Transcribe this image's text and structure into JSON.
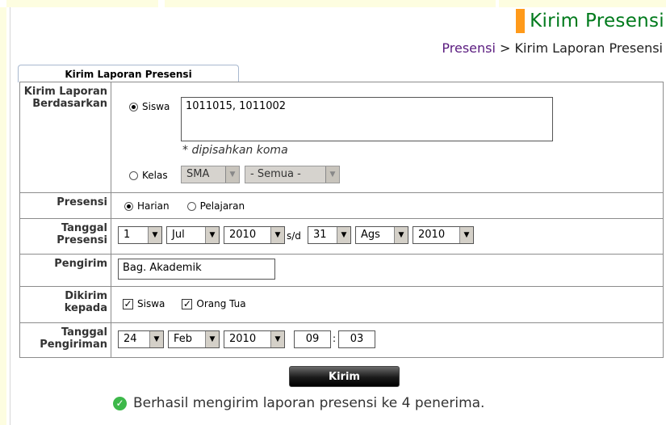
{
  "title": "Kirim Presensi",
  "breadcrumb": {
    "link": "Presensi",
    "separator": ">",
    "current": "Kirim Laporan Presensi"
  },
  "tab": "Kirim Laporan Presensi",
  "rows": {
    "kirim": {
      "label": "Kirim Laporan Berdasarkan",
      "siswa_label": "Siswa",
      "siswa_value": "1011015, 1011002",
      "hint": "* dipisahkan koma",
      "kelas_label": "Kelas",
      "kelas_level": "SMA",
      "kelas_class": "- Semua -"
    },
    "presensi": {
      "label": "Presensi",
      "opt1": "Harian",
      "opt2": "Pelajaran",
      "selected": "Harian"
    },
    "tanggal": {
      "label": "Tanggal Presensi",
      "from_day": "1",
      "from_month": "Jul",
      "from_year": "2010",
      "sep": "s/d",
      "to_day": "31",
      "to_month": "Ags",
      "to_year": "2010"
    },
    "pengirim": {
      "label": "Pengirim",
      "value": "Bag. Akademik"
    },
    "dikirim": {
      "label": "Dikirim kepada",
      "opt1": "Siswa",
      "opt2": "Orang Tua"
    },
    "tanggal_kirim": {
      "label": "Tanggal Pengiriman",
      "day": "24",
      "month": "Feb",
      "year": "2010",
      "hour": "09",
      "minute": "03",
      "colon": ":"
    }
  },
  "submit": "Kirim",
  "message": "Berhasil mengirim laporan presensi ke 4 penerima.",
  "colors": {
    "title": "#007a1c",
    "accent": "#ff9a1a",
    "link": "#5a1b7f",
    "success": "#3db84a"
  },
  "icons": {
    "success": "check-circle-icon",
    "dropdown": "triangle-down-icon"
  }
}
